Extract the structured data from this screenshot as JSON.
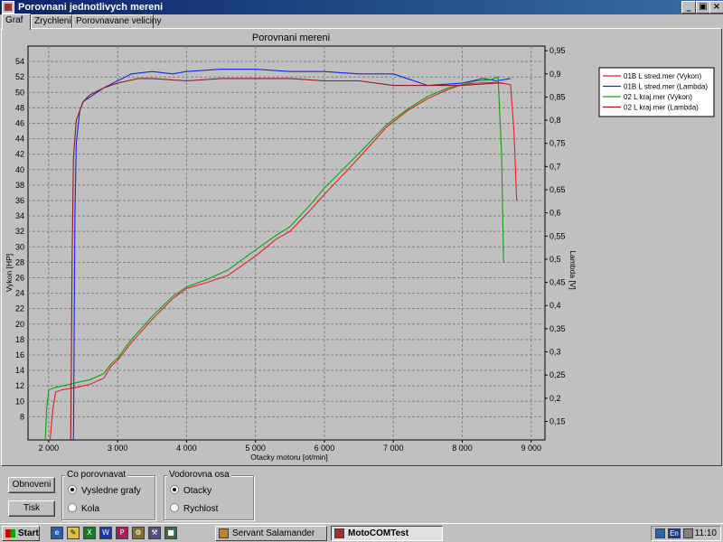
{
  "window": {
    "title": "Porovnani jednotlivych mereni"
  },
  "tabs": [
    {
      "label": "Graf",
      "active": true
    },
    {
      "label": "Zrychleni",
      "active": false
    },
    {
      "label": "Porovnavane veliciny",
      "active": false
    }
  ],
  "chart_data": {
    "type": "line",
    "title": "Porovnani mereni",
    "xlabel": "Otacky motoru [ot/min]",
    "ylabel_left": "Vykon [HP]",
    "ylabel_right": "Lambda [V]",
    "xlim": [
      1700,
      9200
    ],
    "ylim_left": [
      5,
      56
    ],
    "ylim_right": [
      0.11,
      0.96
    ],
    "x_ticks": [
      2000,
      3000,
      4000,
      5000,
      6000,
      7000,
      8000,
      9000
    ],
    "x_tick_labels": [
      "2 000",
      "3 000",
      "4 000",
      "5 000",
      "6 000",
      "7 000",
      "8 000",
      "9 000"
    ],
    "y_left_ticks": [
      8,
      10,
      12,
      14,
      16,
      18,
      20,
      22,
      24,
      26,
      28,
      30,
      32,
      34,
      36,
      38,
      40,
      42,
      44,
      46,
      48,
      50,
      52,
      54
    ],
    "y_left_tick_labels": [
      "8",
      "10",
      "12",
      "14",
      "16",
      "18",
      "20",
      "22",
      "24",
      "26",
      "28",
      "30",
      "32",
      "34",
      "36",
      "38",
      "40",
      "42",
      "44",
      "46",
      "48",
      "50",
      "52",
      "54"
    ],
    "y_right_ticks": [
      0.15,
      0.2,
      0.25,
      0.3,
      0.35,
      0.4,
      0.45,
      0.5,
      0.55,
      0.6,
      0.65,
      0.7,
      0.75,
      0.8,
      0.85,
      0.9,
      0.95
    ],
    "y_right_tick_labels": [
      "0,15",
      "0,2",
      "0,25",
      "0,3",
      "0,35",
      "0,4",
      "0,45",
      "0,5",
      "0,55",
      "0,6",
      "0,65",
      "0,7",
      "0,75",
      "0,8",
      "0,85",
      "0,9",
      "0,95"
    ],
    "grid": true,
    "legend_position": "right",
    "series": [
      {
        "name": "01B L stred.mer  (Vykon)",
        "axis": "left",
        "color": "#e82020",
        "x": [
          2020,
          2060,
          2100,
          2200,
          2400,
          2600,
          2800,
          2900,
          3000,
          3200,
          3500,
          3800,
          4000,
          4300,
          4600,
          5000,
          5300,
          5500,
          5800,
          6000,
          6300,
          6600,
          6900,
          7200,
          7500,
          7800,
          8000,
          8200,
          8500,
          8700,
          8750,
          8790
        ],
        "y": [
          5,
          9,
          11.2,
          11.5,
          11.8,
          12.2,
          13,
          14.5,
          15.3,
          17.6,
          20.6,
          23.3,
          24.6,
          25.4,
          26.3,
          28.8,
          31,
          32,
          34.8,
          36.8,
          39.6,
          42.5,
          45.5,
          47.6,
          49.2,
          50.4,
          51,
          51.2,
          51.3,
          51,
          45,
          36
        ]
      },
      {
        "name": "01B L stred.mer  (Lambda)",
        "axis": "right",
        "color": "#2020e0",
        "x": [
          2360,
          2380,
          2400,
          2450,
          2500,
          2600,
          2800,
          3000,
          3200,
          3500,
          3800,
          4000,
          4500,
          5000,
          5500,
          6000,
          6500,
          7000,
          7500,
          8000,
          8300,
          8500,
          8700
        ],
        "y": [
          0.11,
          0.6,
          0.75,
          0.82,
          0.84,
          0.85,
          0.87,
          0.885,
          0.9,
          0.905,
          0.9,
          0.905,
          0.91,
          0.91,
          0.905,
          0.905,
          0.9,
          0.9,
          0.875,
          0.88,
          0.89,
          0.885,
          0.89
        ]
      },
      {
        "name": "02 L kraj.mer  (Vykon)",
        "axis": "left",
        "color": "#10a010",
        "x": [
          1950,
          1970,
          2000,
          2100,
          2200,
          2400,
          2600,
          2800,
          2900,
          3000,
          3200,
          3500,
          3800,
          4000,
          4300,
          4600,
          5000,
          5300,
          5500,
          5800,
          6000,
          6300,
          6600,
          6900,
          7200,
          7500,
          7800,
          8000,
          8200,
          8400,
          8520,
          8570,
          8600
        ],
        "y": [
          5,
          9,
          11.5,
          11.8,
          12,
          12.4,
          12.8,
          13.6,
          14.8,
          15.6,
          18,
          21,
          23.6,
          24.8,
          25.8,
          27,
          29.6,
          31.5,
          32.6,
          35.5,
          37.6,
          40.3,
          43,
          45.8,
          47.8,
          49.5,
          50.6,
          51,
          51.5,
          51.6,
          52,
          42,
          28
        ]
      },
      {
        "name": "02 L kraj.mer  (Lambda)",
        "axis": "right",
        "color": "#901820",
        "x": [
          2320,
          2340,
          2360,
          2400,
          2500,
          2600,
          2800,
          3000,
          3300,
          3500,
          4000,
          4500,
          5000,
          5500,
          6000,
          6500,
          7000,
          7500,
          8000,
          8500,
          8600
        ],
        "y": [
          0.11,
          0.5,
          0.72,
          0.8,
          0.84,
          0.855,
          0.87,
          0.88,
          0.89,
          0.89,
          0.885,
          0.89,
          0.89,
          0.89,
          0.885,
          0.885,
          0.875,
          0.875,
          0.875,
          0.88,
          0.88
        ]
      }
    ]
  },
  "bottom": {
    "btn_refresh": "Obnoveni",
    "btn_print": "Tisk",
    "compare_group": {
      "label": "Co porovnavat",
      "opt1": "Vysledne grafy",
      "opt2": "Kola",
      "selected": "opt1"
    },
    "axis_group": {
      "label": "Vodorovna osa",
      "opt1": "Otacky",
      "opt2": "Rychlost",
      "selected": "opt1"
    }
  },
  "taskbar": {
    "start": "Start",
    "tasks": [
      {
        "label": "Servant Salamander",
        "active": false
      },
      {
        "label": "MotoCOMTest",
        "active": true
      }
    ],
    "tray_lang": "En",
    "clock": "11:10"
  }
}
